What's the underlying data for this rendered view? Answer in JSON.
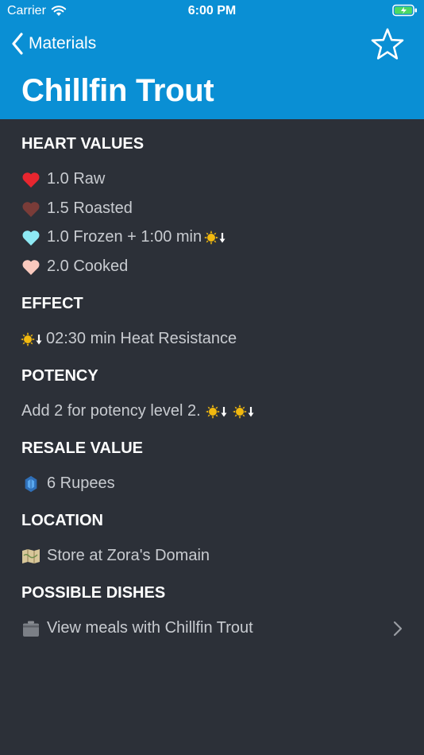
{
  "status_bar": {
    "carrier": "Carrier",
    "time": "6:00 PM",
    "icons": [
      "wifi-icon",
      "battery-charging-icon"
    ]
  },
  "nav": {
    "back_label": "Materials",
    "back_icon": "chevron-left-icon",
    "favorite_icon": "star-outline-icon"
  },
  "title": "Chillfin Trout",
  "sections": {
    "heart_values": {
      "header": "HEART VALUES",
      "items": [
        {
          "text": "1.0 Raw",
          "icon": "heart-red-icon",
          "color": "#e8262f"
        },
        {
          "text": "1.5 Roasted",
          "icon": "heart-brown-icon",
          "color": "#7a3c38"
        },
        {
          "text": "1.0 Frozen + 1:00 min",
          "icon": "heart-cyan-icon",
          "color": "#8ee9f4",
          "suffix_icon": "heat-resistance-icon"
        },
        {
          "text": "2.0 Cooked",
          "icon": "heart-peach-icon",
          "color": "#f9c9be"
        }
      ]
    },
    "effect": {
      "header": "EFFECT",
      "text": "02:30 min Heat Resistance",
      "icon": "heat-resistance-icon"
    },
    "potency": {
      "header": "POTENCY",
      "text": "Add 2 for potency level 2.",
      "suffix_icons": [
        "heat-resistance-icon",
        "heat-resistance-icon"
      ]
    },
    "resale": {
      "header": "RESALE VALUE",
      "text": "6 Rupees",
      "icon": "rupee-icon",
      "color": "#3f8fd8"
    },
    "location": {
      "header": "LOCATION",
      "text": "Store at Zora's Domain",
      "icon": "map-icon"
    },
    "dishes": {
      "header": "POSSIBLE DISHES",
      "text": "View meals with Chillfin Trout",
      "icon": "cooking-pot-icon",
      "chevron": "chevron-right-icon"
    }
  },
  "colors": {
    "header_bg": "#0a8fd4",
    "page_bg": "#2c3038"
  }
}
